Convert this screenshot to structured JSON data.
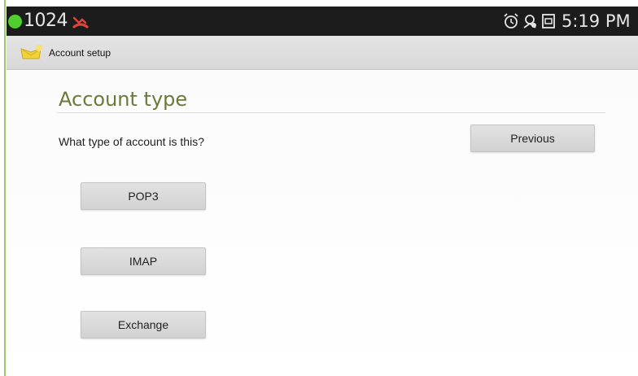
{
  "status_bar": {
    "count": "1024",
    "time": "5:19 PM",
    "icons": [
      "status-dot-icon",
      "missed-call-icon",
      "alarm-icon",
      "sync-icon",
      "screenshot-icon"
    ],
    "colors": {
      "background": "#1c1c1c",
      "dot": "#4fcf2e",
      "missed_call": "#e0453a"
    }
  },
  "action_bar": {
    "title": "Account setup",
    "icon": "app-icon"
  },
  "main": {
    "title": "Account type",
    "question": "What type of account is this?",
    "previous_label": "Previous",
    "options": [
      {
        "label": "POP3"
      },
      {
        "label": "IMAP"
      },
      {
        "label": "Exchange"
      }
    ],
    "colors": {
      "title": "#6b7a3a"
    }
  }
}
